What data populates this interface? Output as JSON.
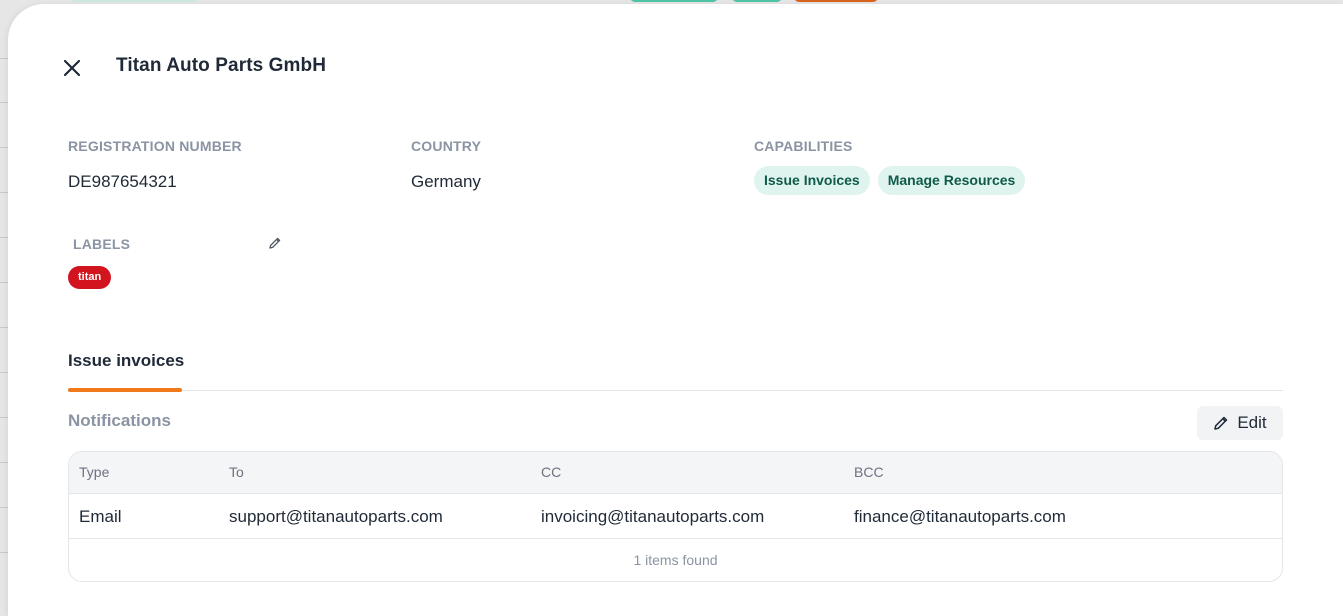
{
  "header": {
    "title": "Titan Auto Parts GmbH"
  },
  "details": {
    "registration": {
      "label": "REGISTRATION NUMBER",
      "value": "DE987654321"
    },
    "country": {
      "label": "COUNTRY",
      "value": "Germany"
    },
    "capabilities": {
      "label": "CAPABILITIES",
      "items": [
        "Issue Invoices",
        "Manage Resources"
      ]
    },
    "labels": {
      "label": "LABELS",
      "items": [
        "titan"
      ]
    }
  },
  "tabs": [
    {
      "label": "Issue invoices",
      "active": true
    }
  ],
  "notifications": {
    "title": "Notifications",
    "edit_label": "Edit",
    "columns": [
      "Type",
      "To",
      "CC",
      "BCC"
    ],
    "rows": [
      {
        "type": "Email",
        "to": "support@titanautoparts.com",
        "cc": "invoicing@titanautoparts.com",
        "bcc": "finance@titanautoparts.com"
      }
    ],
    "footer": "1 items found"
  },
  "colors": {
    "accent": "#f07a1a",
    "capability_bg": "#dff4ee",
    "capability_text": "#0f5a4a",
    "label_bg": "#d2141e"
  },
  "icons": {
    "close": "close-icon",
    "edit_labels": "pencil-icon",
    "edit_notifications": "pencil-icon"
  }
}
